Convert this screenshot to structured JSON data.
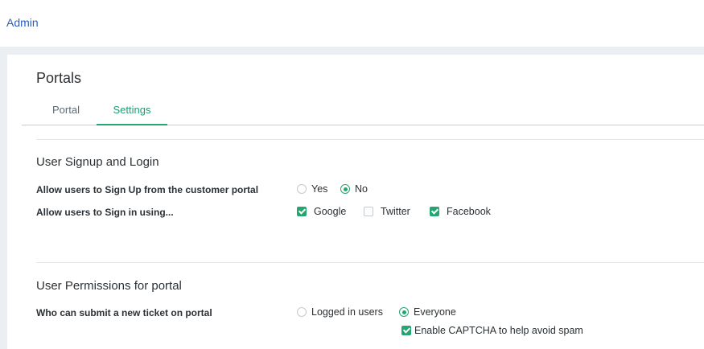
{
  "header": {
    "breadcrumb": "Admin"
  },
  "page": {
    "title": "Portals"
  },
  "tabs": [
    {
      "label": "Portal",
      "active": false
    },
    {
      "label": "Settings",
      "active": true
    }
  ],
  "signup_section": {
    "title": "User Signup and Login",
    "signup_row": {
      "label": "Allow users to Sign Up from the customer portal",
      "options": [
        {
          "label": "Yes",
          "selected": false
        },
        {
          "label": "No",
          "selected": true
        }
      ]
    },
    "signin_row": {
      "label": "Allow users to Sign in using...",
      "options": [
        {
          "label": "Google",
          "checked": true
        },
        {
          "label": "Twitter",
          "checked": false
        },
        {
          "label": "Facebook",
          "checked": true
        }
      ]
    }
  },
  "permissions_section": {
    "title": "User Permissions for portal",
    "submit_row": {
      "label": "Who can submit a new ticket on portal",
      "options": [
        {
          "label": "Logged in users",
          "selected": false
        },
        {
          "label": "Everyone",
          "selected": true
        }
      ],
      "captcha": {
        "label": "Enable CAPTCHA to help avoid spam",
        "checked": true
      }
    }
  },
  "colors": {
    "accent": "#23a66f",
    "link": "#2a5fb8",
    "background": "#ebeef2"
  }
}
